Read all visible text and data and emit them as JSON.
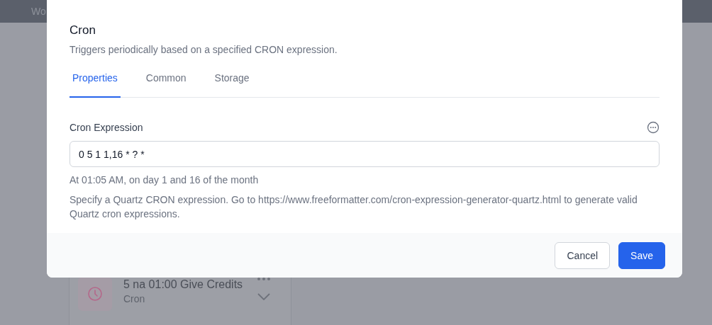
{
  "background": {
    "nav_items": [
      "Wo"
    ],
    "card": {
      "title": "5 na 01:00 Give Credits",
      "subtitle": "Cron"
    }
  },
  "dialog": {
    "title": "Cron",
    "description": "Triggers periodically based on a specified CRON expression.",
    "tabs": [
      {
        "label": "Properties",
        "selected": true
      },
      {
        "label": "Common",
        "selected": false
      },
      {
        "label": "Storage",
        "selected": false
      }
    ],
    "field": {
      "label": "Cron Expression",
      "value": "0 5 1 1,16 * ? *",
      "summary": "At 01:05 AM, on day 1 and 16 of the month",
      "help": "Specify a Quartz CRON expression. Go to https://www.freeformatter.com/cron-expression-generator-quartz.html to generate valid Quartz cron expressions."
    },
    "buttons": [
      {
        "label": "Cancel",
        "kind": "secondary"
      },
      {
        "label": "Save",
        "kind": "primary"
      }
    ]
  }
}
